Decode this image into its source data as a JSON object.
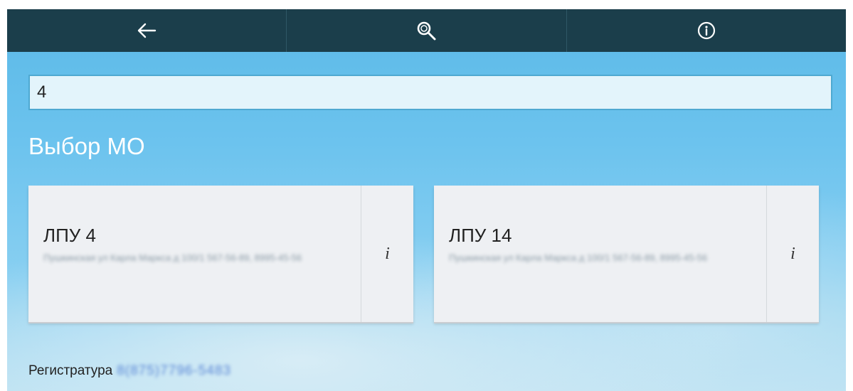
{
  "toolbar": {
    "back_icon": "arrow-left-icon",
    "search_icon": "search-icon",
    "info_icon": "info-circle-icon"
  },
  "search": {
    "value": "4"
  },
  "section_title": "Выбор МО",
  "cards": [
    {
      "title": "ЛПУ 4",
      "subtitle": "Пушкинская ул Карла Маркса д 100/1 567-56-89, 8995-45-56",
      "info_label": "i"
    },
    {
      "title": "ЛПУ 14",
      "subtitle": "Пушкинская ул Карла Маркса д 100/1 567-56-89, 8995-45-56",
      "info_label": "i"
    }
  ],
  "footer": {
    "label": "Регистратура",
    "phone": "8(875)7796-5483"
  },
  "colors": {
    "topbar": "#1b3e4b",
    "accent": "#4ea9d1",
    "card": "#eef0f3"
  }
}
